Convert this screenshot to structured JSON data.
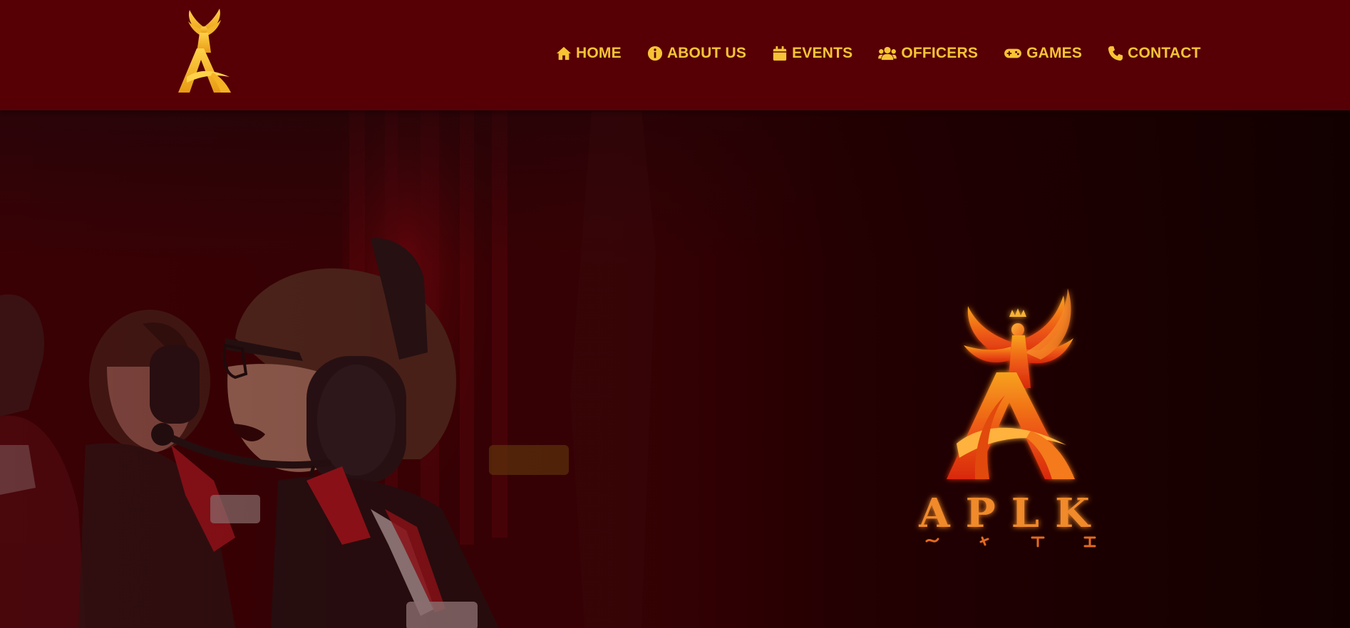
{
  "header": {
    "logo_icon": "phoenix-a-logo",
    "nav": [
      {
        "label": "HOME",
        "icon": "home-icon"
      },
      {
        "label": "ABOUT US",
        "icon": "info-icon"
      },
      {
        "label": "EVENTS",
        "icon": "calendar-icon"
      },
      {
        "label": "OFFICERS",
        "icon": "users-icon"
      },
      {
        "label": "GAMES",
        "icon": "gamepad-icon"
      },
      {
        "label": "CONTACT",
        "icon": "phone-icon"
      }
    ]
  },
  "hero": {
    "emblem": {
      "wordmark": "APLK",
      "icon": "phoenix-emblem"
    }
  },
  "colors": {
    "header_bg": "#560006",
    "nav_text": "#f7c335",
    "hero_overlay": "#3d0004",
    "emblem_orange": "#f07a20"
  }
}
